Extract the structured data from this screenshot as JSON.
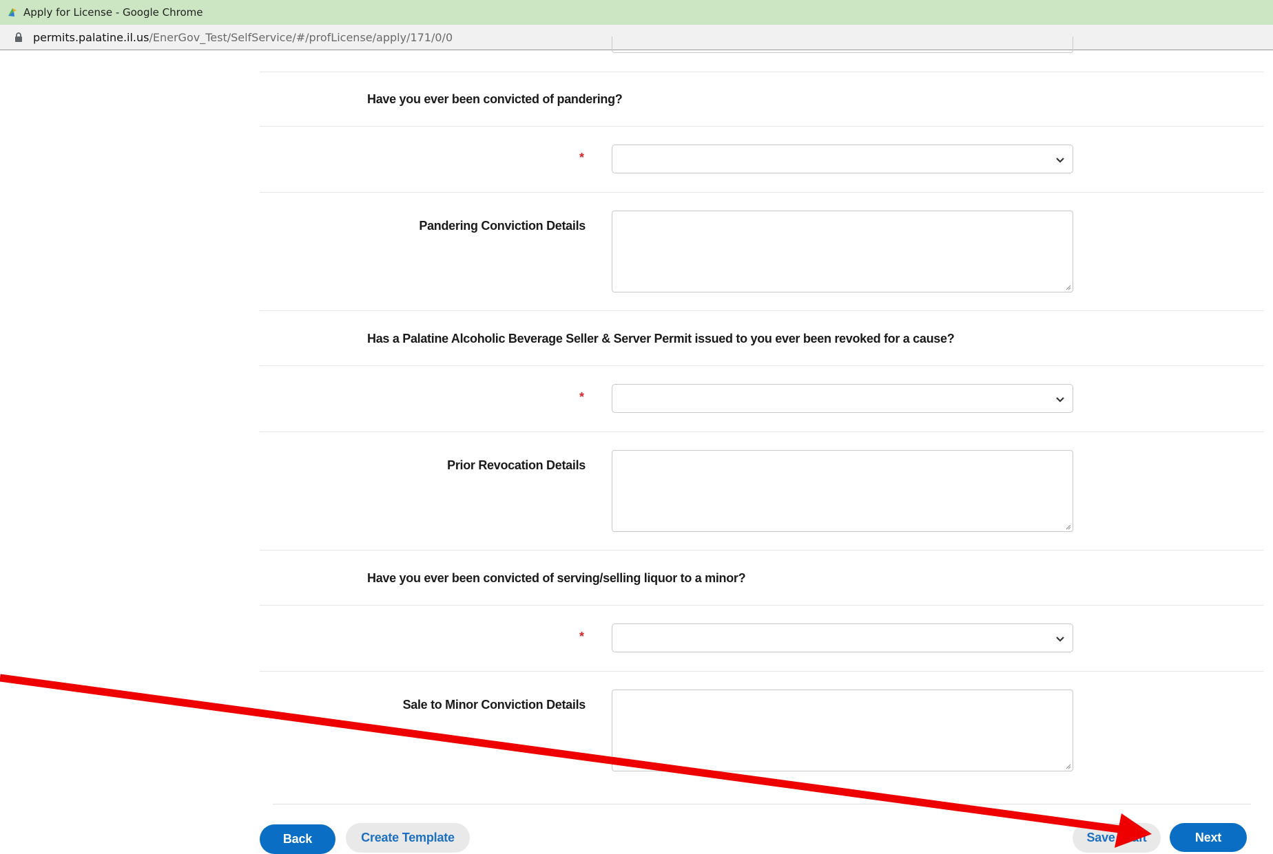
{
  "browser": {
    "window_title": "Apply for License - Google Chrome",
    "url_host": "permits.palatine.il.us",
    "url_path": "/EnerGov_Test/SelfService/#/profLicense/apply/171/0/0"
  },
  "form": {
    "required_marker": "*",
    "q1": {
      "question": "Have you ever been convicted of pandering?",
      "select_value": "",
      "details_label": "Pandering Conviction Details",
      "details_value": ""
    },
    "q2": {
      "question": "Has a Palatine Alcoholic Beverage Seller & Server Permit issued to you ever been revoked for a cause?",
      "select_value": "",
      "details_label": "Prior Revocation Details",
      "details_value": ""
    },
    "q3": {
      "question": "Have you ever been convicted of serving/selling liquor to a minor?",
      "select_value": "",
      "details_label": "Sale to Minor Conviction Details",
      "details_value": ""
    }
  },
  "actions": {
    "back": "Back",
    "create_template": "Create Template",
    "save_draft": "Save Draft",
    "next": "Next"
  },
  "colors": {
    "primary": "#0a6ec4",
    "required": "#d9262b",
    "annotation_arrow": "#ee0000",
    "titlebar": "#cce5c2"
  },
  "icons": {
    "app": "app-logo-icon",
    "lock": "lock-icon",
    "chevron": "chevron-down-icon",
    "grip": "resize-grip-icon",
    "arrow": "red-arrow-annotation"
  }
}
